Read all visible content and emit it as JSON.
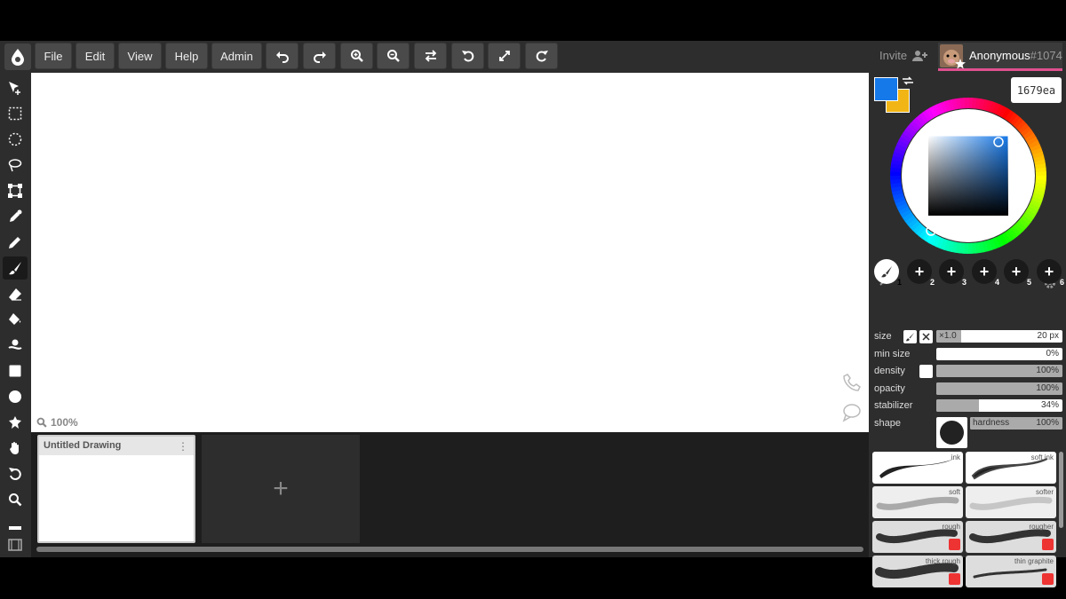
{
  "menu": {
    "file": "File",
    "edit": "Edit",
    "view": "View",
    "help": "Help",
    "admin": "Admin"
  },
  "toolbar_icons": [
    "undo-icon",
    "redo-icon",
    "zoom-in-icon",
    "zoom-out-icon",
    "flip-icon",
    "rotate-left-icon",
    "fullscreen-icon",
    "rotate-right-icon"
  ],
  "invite_label": "Invite",
  "user": {
    "name": "Anonymous",
    "number": "#1074"
  },
  "canvas": {
    "zoom": "100%"
  },
  "files": {
    "drawing_title": "Untitled Drawing",
    "add_label": "+"
  },
  "color": {
    "primary": "#1679ea",
    "secondary": "#f1b516",
    "hex": "1679ea"
  },
  "brush_slots": [
    "1",
    "2",
    "3",
    "4",
    "5",
    "6"
  ],
  "brush_settings": {
    "size": {
      "label": "size",
      "multiplier": "×1.0",
      "value": "20 px"
    },
    "min_size": {
      "label": "min size",
      "value": "0%",
      "fraction": 0.0
    },
    "density": {
      "label": "density",
      "value": "100%",
      "fraction": 1.0
    },
    "opacity": {
      "label": "opacity",
      "value": "100%",
      "fraction": 1.0
    },
    "stabilizer": {
      "label": "stabilizer",
      "value": "34%",
      "fraction": 0.34
    },
    "shape": {
      "label": "shape",
      "hardness_label": "hardness",
      "hardness_value": "100%"
    }
  },
  "brushes": [
    "ink",
    "soft ink",
    "soft",
    "softer",
    "rough",
    "rougher",
    "thick rough",
    "thin graphite"
  ]
}
